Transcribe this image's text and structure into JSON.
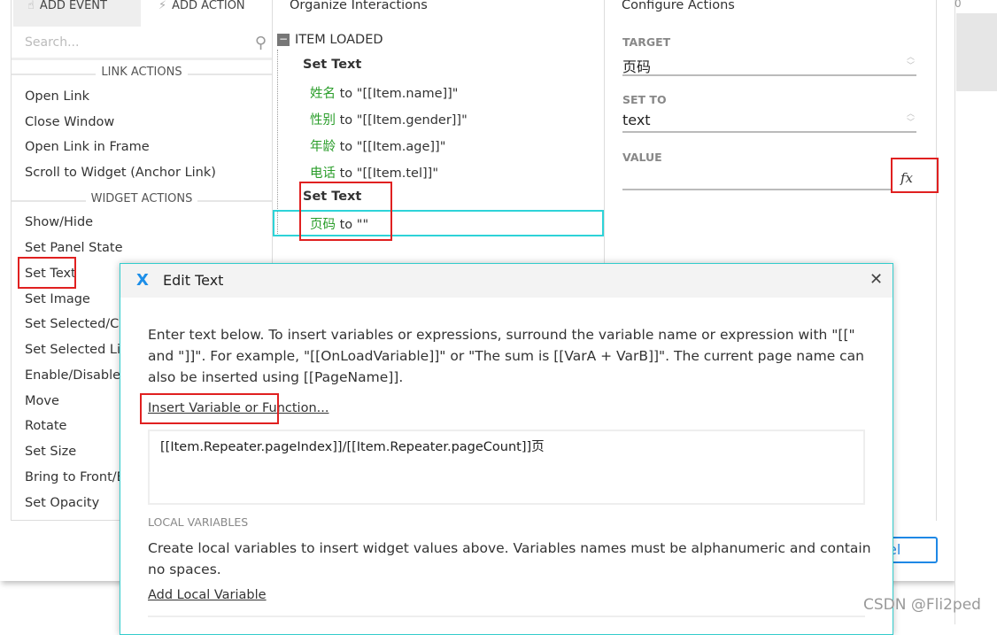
{
  "tabs": {
    "add_event": "ADD EVENT",
    "add_action": "ADD ACTION"
  },
  "search": {
    "placeholder": "Search..."
  },
  "link_actions": {
    "header": "LINK ACTIONS",
    "items": [
      "Open Link",
      "Close Window",
      "Open Link in Frame",
      "Scroll to Widget (Anchor Link)"
    ]
  },
  "widget_actions": {
    "header": "WIDGET ACTIONS",
    "items": [
      "Show/Hide",
      "Set Panel State",
      "Set Text",
      "Set Image",
      "Set Selected/Ch",
      "Set Selected Lis",
      "Enable/Disable",
      "Move",
      "Rotate",
      "Set Size",
      "Bring to Front/B",
      "Set Opacity"
    ]
  },
  "organize": {
    "title": "Organize Interactions",
    "event": "ITEM LOADED",
    "actions": [
      {
        "label": "Set Text",
        "assignments": [
          {
            "target": "姓名",
            "rest": " to \"[[Item.name]]\""
          },
          {
            "target": "性别",
            "rest": " to \"[[Item.gender]]\""
          },
          {
            "target": "年龄",
            "rest": " to \"[[Item.age]]\""
          },
          {
            "target": "电话",
            "rest": " to \"[[Item.tel]]\""
          }
        ]
      },
      {
        "label": "Set Text",
        "assignments": [
          {
            "target": "页码",
            "rest": " to \"\""
          }
        ]
      }
    ]
  },
  "configure": {
    "title": "Configure Actions",
    "target_label": "TARGET",
    "target_value": "页码",
    "setto_label": "SET TO",
    "setto_value": "text",
    "value_label": "VALUE",
    "fx": "fx"
  },
  "ruler": "0",
  "cancel_label": "el",
  "dialog": {
    "title": "Edit Text",
    "intro": "Enter text below. To insert variables or expressions, surround the variable name or expression with \"[[\" and \"]]\". For example, \"[[OnLoadVariable]]\" or \"The sum is [[VarA + VarB]]\". The current page name can also be inserted using [[PageName]].",
    "insert_link": "Insert Variable or Function...",
    "text_value": "[[Item.Repeater.pageIndex]]/[[Item.Repeater.pageCount]]页",
    "local_vars_header": "LOCAL VARIABLES",
    "local_vars_desc": "Create local variables to insert widget values above. Variables names must be alphanumeric and contain no spaces.",
    "add_local": "Add Local Variable"
  },
  "watermark": "CSDN @Fli2ped",
  "colors": {
    "accent": "#2ed3d8",
    "highlight": "#e02020",
    "target_green": "#2a9d2a",
    "button_blue": "#1e88e5"
  }
}
